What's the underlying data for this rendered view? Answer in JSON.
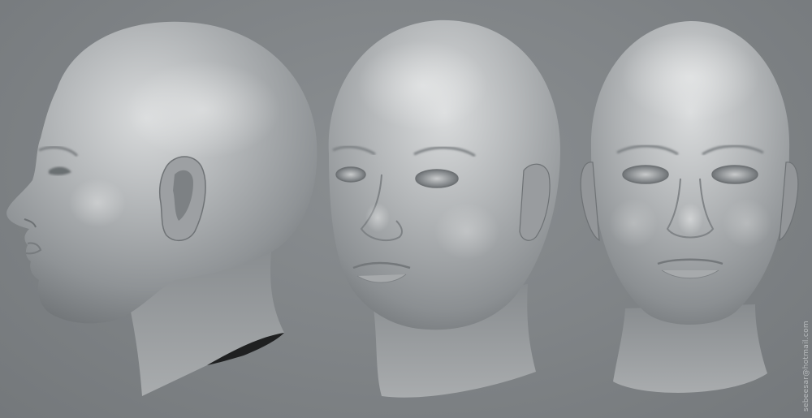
{
  "scene": {
    "background_color": "#808487",
    "skin_color": "#9fa2a5",
    "views": [
      {
        "id": "side-profile",
        "description_name": "left profile view"
      },
      {
        "id": "three-quarter",
        "description_name": "three-quarter view"
      },
      {
        "id": "front",
        "description_name": "front view"
      }
    ]
  },
  "signature": {
    "text": "sebeesar@hotmail.com"
  }
}
